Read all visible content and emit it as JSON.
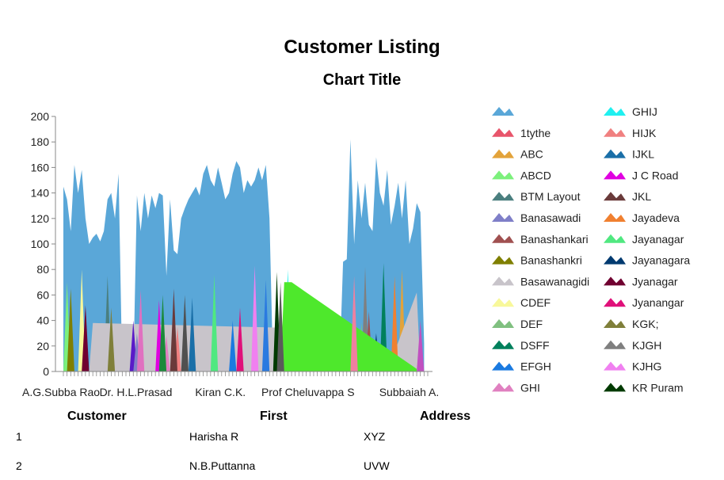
{
  "report": {
    "title": "Customer Listing",
    "columns": [
      "Customer",
      "First",
      "Address"
    ],
    "rows": [
      {
        "id": "1",
        "first": "Harisha R",
        "address": "XYZ"
      },
      {
        "id": "2",
        "first": "N.B.Puttanna",
        "address": "UVW"
      }
    ]
  },
  "chart_data": {
    "type": "area",
    "title": "Chart Title",
    "xlabel": "",
    "ylabel": "",
    "ylim": [
      0,
      200
    ],
    "y_ticks": [
      0,
      20,
      40,
      60,
      80,
      100,
      120,
      140,
      160,
      180,
      200
    ],
    "x_labels": [
      "A.G.Subba Rao",
      "Dr. H.L.Prasad",
      "Kiran C.K.",
      "Prof Cheluvappa S",
      "Subbaiah A."
    ],
    "x_label_positions": [
      0,
      21,
      47,
      65,
      97
    ],
    "x_count": 100,
    "grid": false,
    "legend": "right",
    "legend_columns": 2,
    "series": [
      {
        "name": "",
        "color": "#5aa7d8",
        "points": [
          [
            0,
            145
          ],
          [
            1,
            135
          ],
          [
            2,
            110
          ],
          [
            3,
            162
          ],
          [
            4,
            140
          ],
          [
            5,
            158
          ],
          [
            6,
            120
          ],
          [
            7,
            100
          ],
          [
            8,
            105
          ],
          [
            9,
            108
          ],
          [
            10,
            102
          ],
          [
            11,
            110
          ],
          [
            12,
            135
          ],
          [
            13,
            140
          ],
          [
            14,
            120
          ],
          [
            15,
            155
          ],
          [
            16,
            0
          ],
          [
            17,
            0
          ],
          [
            18,
            0
          ],
          [
            19,
            0
          ],
          [
            20,
            138
          ],
          [
            21,
            110
          ],
          [
            22,
            140
          ],
          [
            23,
            120
          ],
          [
            24,
            138
          ],
          [
            25,
            128
          ],
          [
            26,
            140
          ],
          [
            27,
            138
          ],
          [
            28,
            75
          ],
          [
            29,
            135
          ],
          [
            30,
            95
          ],
          [
            31,
            92
          ],
          [
            32,
            120
          ],
          [
            33,
            128
          ],
          [
            34,
            135
          ],
          [
            35,
            140
          ],
          [
            36,
            145
          ],
          [
            37,
            138
          ],
          [
            38,
            155
          ],
          [
            39,
            162
          ],
          [
            40,
            150
          ],
          [
            41,
            145
          ],
          [
            42,
            160
          ],
          [
            43,
            148
          ],
          [
            44,
            135
          ],
          [
            45,
            140
          ],
          [
            46,
            155
          ],
          [
            47,
            165
          ],
          [
            48,
            160
          ],
          [
            49,
            140
          ],
          [
            50,
            150
          ],
          [
            51,
            145
          ],
          [
            52,
            150
          ],
          [
            53,
            160
          ],
          [
            54,
            150
          ],
          [
            55,
            162
          ],
          [
            56,
            120
          ],
          [
            57,
            0
          ],
          [
            58,
            0
          ],
          [
            59,
            0
          ],
          [
            60,
            0
          ],
          [
            61,
            0
          ],
          [
            62,
            0
          ],
          [
            63,
            0
          ],
          [
            64,
            0
          ],
          [
            65,
            0
          ],
          [
            66,
            0
          ],
          [
            67,
            0
          ],
          [
            68,
            0
          ],
          [
            69,
            0
          ],
          [
            70,
            0
          ],
          [
            71,
            0
          ],
          [
            72,
            0
          ],
          [
            73,
            0
          ],
          [
            74,
            0
          ],
          [
            75,
            0
          ],
          [
            76,
            86
          ],
          [
            77,
            88
          ],
          [
            78,
            182
          ],
          [
            79,
            100
          ],
          [
            80,
            150
          ],
          [
            81,
            120
          ],
          [
            82,
            148
          ],
          [
            83,
            115
          ],
          [
            84,
            110
          ],
          [
            85,
            168
          ],
          [
            86,
            140
          ],
          [
            87,
            130
          ],
          [
            88,
            158
          ],
          [
            89,
            115
          ],
          [
            90,
            130
          ],
          [
            91,
            148
          ],
          [
            92,
            120
          ],
          [
            93,
            150
          ],
          [
            94,
            100
          ],
          [
            95,
            112
          ],
          [
            96,
            132
          ],
          [
            97,
            125
          ],
          [
            98,
            22
          ]
        ]
      },
      {
        "name": "1tythe",
        "color": "#e8556b",
        "points": [
          [
            64,
            0
          ],
          [
            65,
            25
          ],
          [
            66,
            0
          ]
        ]
      },
      {
        "name": "ABC",
        "color": "#e3a33a",
        "points": [
          [
            91,
            0
          ],
          [
            92,
            80
          ],
          [
            93,
            0
          ]
        ]
      },
      {
        "name": "ABCD",
        "color": "#7cf07c",
        "points": [
          [
            0,
            0
          ],
          [
            1,
            70
          ],
          [
            2,
            0
          ]
        ]
      },
      {
        "name": "BTM Layout",
        "color": "#4a7f7f",
        "points": [
          [
            11,
            0
          ],
          [
            12,
            75
          ],
          [
            13,
            0
          ]
        ]
      },
      {
        "name": "Banasawadi",
        "color": "#7f7fc8",
        "points": [
          [
            21,
            0
          ],
          [
            22,
            38
          ],
          [
            23,
            0
          ]
        ]
      },
      {
        "name": "Banashankari",
        "color": "#a05050",
        "points": [
          [
            82,
            0
          ],
          [
            83,
            47
          ],
          [
            84,
            0
          ]
        ]
      },
      {
        "name": "Banashankri",
        "color": "#7f7f00",
        "points": [
          [
            1,
            0
          ],
          [
            2,
            65
          ],
          [
            3,
            0
          ]
        ]
      },
      {
        "name": "Basawanagidi",
        "color": "#c8c4ca",
        "points": [
          [
            7,
            0
          ],
          [
            8,
            38
          ],
          [
            64,
            34
          ],
          [
            66,
            0
          ],
          [
            88,
            0
          ],
          [
            96,
            62
          ],
          [
            97,
            0
          ]
        ]
      },
      {
        "name": "CDEF",
        "color": "#f8f89a",
        "points": [
          [
            4,
            0
          ],
          [
            5,
            80
          ],
          [
            6,
            0
          ]
        ]
      },
      {
        "name": "DEF",
        "color": "#80c080",
        "points": [
          [
            80,
            0
          ],
          [
            81,
            38
          ],
          [
            82,
            0
          ]
        ]
      },
      {
        "name": "DSFF",
        "color": "#00805c",
        "points": [
          [
            86,
            0
          ],
          [
            87,
            85
          ],
          [
            88,
            0
          ]
        ]
      },
      {
        "name": "EFGH",
        "color": "#1a7ae0",
        "points": [
          [
            45,
            0
          ],
          [
            46,
            40
          ],
          [
            47,
            0
          ]
        ]
      },
      {
        "name": "GHI",
        "color": "#e080c0",
        "points": [
          [
            27,
            0
          ],
          [
            28,
            28
          ],
          [
            29,
            0
          ]
        ]
      },
      {
        "name": "GHIJ",
        "color": "#20f0f0",
        "points": [
          [
            60,
            0
          ],
          [
            61,
            80
          ],
          [
            62,
            0
          ]
        ]
      },
      {
        "name": "HIJK",
        "color": "#f08080",
        "points": [
          [
            30,
            0
          ],
          [
            31,
            35
          ],
          [
            32,
            0
          ]
        ]
      },
      {
        "name": "IJKL",
        "color": "#1a6fa8",
        "points": [
          [
            34,
            0
          ],
          [
            35,
            58
          ],
          [
            36,
            0
          ]
        ]
      },
      {
        "name": "J C Road",
        "color": "#e000e0",
        "points": [
          [
            25,
            0
          ],
          [
            26,
            56
          ],
          [
            27,
            0
          ]
        ]
      },
      {
        "name": "JKL",
        "color": "#6a3a3a",
        "points": [
          [
            29,
            0
          ],
          [
            30,
            65
          ],
          [
            31,
            0
          ]
        ]
      },
      {
        "name": "Jayadeva",
        "color": "#f08030",
        "points": [
          [
            89,
            0
          ],
          [
            90,
            75
          ],
          [
            91,
            0
          ]
        ]
      },
      {
        "name": "Jayanagar",
        "color": "#50e880",
        "points": [
          [
            40,
            0
          ],
          [
            41,
            76
          ],
          [
            42,
            0
          ]
        ]
      },
      {
        "name": "Jayanagara",
        "color": "#003a70",
        "points": [
          [
            84,
            0
          ],
          [
            85,
            30
          ],
          [
            86,
            0
          ]
        ]
      },
      {
        "name": "Jyanagar",
        "color": "#700030",
        "points": [
          [
            5,
            0
          ],
          [
            6,
            52
          ],
          [
            7,
            0
          ]
        ]
      },
      {
        "name": "Jyanangar",
        "color": "#e0107a",
        "points": [
          [
            47,
            0
          ],
          [
            48,
            50
          ],
          [
            49,
            0
          ]
        ]
      },
      {
        "name": "KGK;",
        "color": "#7f7f3a",
        "points": [
          [
            12,
            0
          ],
          [
            13,
            50
          ],
          [
            14,
            0
          ]
        ]
      },
      {
        "name": "KJGH",
        "color": "#7f7f7f",
        "points": [
          [
            81,
            0
          ],
          [
            82,
            82
          ],
          [
            83,
            0
          ]
        ]
      },
      {
        "name": "KJHG",
        "color": "#f080f0",
        "points": [
          [
            51,
            0
          ],
          [
            52,
            83
          ],
          [
            53,
            0
          ]
        ]
      },
      {
        "name": "KR Puram",
        "color": "#003a00",
        "points": [
          [
            57,
            0
          ],
          [
            58,
            78
          ],
          [
            59,
            0
          ]
        ]
      },
      {
        "name": "",
        "color": "#4ee82c",
        "points": [
          [
            59,
            0
          ],
          [
            60,
            70
          ],
          [
            62,
            70
          ],
          [
            96,
            2
          ],
          [
            96,
            0
          ]
        ]
      },
      {
        "name": "",
        "color": "#5a1ac8",
        "points": [
          [
            18,
            0
          ],
          [
            19,
            40
          ],
          [
            20,
            0
          ]
        ]
      },
      {
        "name": "",
        "color": "#8080c8",
        "points": [
          [
            19,
            0
          ],
          [
            20,
            30
          ],
          [
            21,
            0
          ]
        ]
      },
      {
        "name": "",
        "color": "#e070c0",
        "points": [
          [
            20,
            0
          ],
          [
            21,
            64
          ],
          [
            22,
            0
          ]
        ]
      },
      {
        "name": "",
        "color": "#505050",
        "points": [
          [
            32,
            0
          ],
          [
            33,
            60
          ],
          [
            34,
            0
          ]
        ]
      },
      {
        "name": "",
        "color": "#5a5a5a",
        "points": [
          [
            58,
            0
          ],
          [
            59,
            70
          ],
          [
            60,
            0
          ]
        ]
      },
      {
        "name": "",
        "color": "#c050c0",
        "points": [
          [
            96,
            0
          ],
          [
            97,
            40
          ],
          [
            98,
            0
          ]
        ]
      },
      {
        "name": "",
        "color": "#1a8a3a",
        "points": [
          [
            26,
            0
          ],
          [
            27,
            60
          ],
          [
            28,
            0
          ]
        ]
      },
      {
        "name": "",
        "color": "#2a7ae0",
        "points": [
          [
            54,
            0
          ],
          [
            55,
            72
          ],
          [
            56,
            0
          ]
        ]
      },
      {
        "name": "",
        "color": "#f080a0",
        "points": [
          [
            78,
            0
          ],
          [
            79,
            75
          ],
          [
            80,
            0
          ]
        ]
      }
    ]
  }
}
